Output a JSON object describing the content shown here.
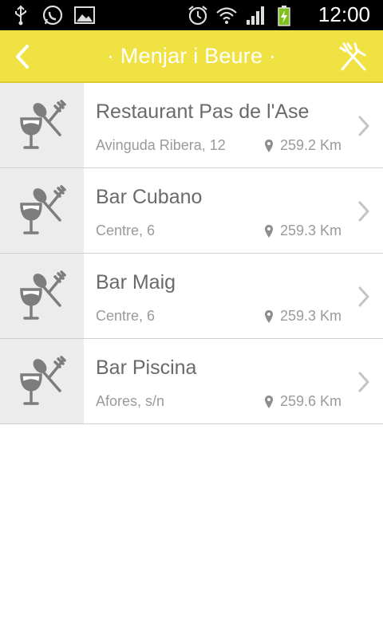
{
  "status_bar": {
    "left_icons": [
      "usb-icon",
      "whatsapp-icon",
      "gallery-icon"
    ],
    "right_icons": [
      "alarm-icon",
      "wifi-icon",
      "signal-icon",
      "battery-charging-icon"
    ],
    "time": "12:00"
  },
  "header": {
    "title": "· Menjar i Beure ·",
    "back_icon": "chevron-left-icon",
    "action_icon": "fork-knife-icon",
    "background_color": "#f1e243"
  },
  "list": {
    "items": [
      {
        "name": "Restaurant Pas de l'Ase",
        "address": "Avinguda Ribera, 12",
        "distance": "259.2 Km",
        "icon": "wine-spoon-fork-icon"
      },
      {
        "name": "Bar Cubano",
        "address": "Centre, 6",
        "distance": "259.3 Km",
        "icon": "wine-spoon-fork-icon"
      },
      {
        "name": "Bar Maig",
        "address": "Centre, 6",
        "distance": "259.3 Km",
        "icon": "wine-spoon-fork-icon"
      },
      {
        "name": "Bar Piscina",
        "address": "Afores, s/n",
        "distance": "259.6 Km",
        "icon": "wine-spoon-fork-icon"
      }
    ]
  }
}
